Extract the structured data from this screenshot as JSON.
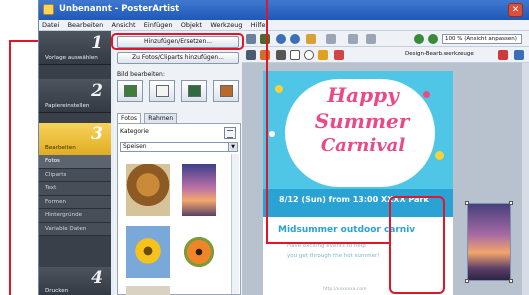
{
  "window": {
    "title": "Unbenannt - PosterArtist",
    "close_glyph": "✕"
  },
  "menubar": {
    "items": [
      "Datei",
      "Bearbeiten",
      "Ansicht",
      "Einfügen",
      "Objekt",
      "Werkzeug",
      "Hilfe"
    ]
  },
  "steps": [
    {
      "number": "1",
      "label": "Vorlage auswählen"
    },
    {
      "number": "2",
      "label": "Papiereinstellen"
    },
    {
      "number": "3",
      "label": "Bearbeiten"
    },
    {
      "number": "4",
      "label": "Drucken"
    }
  ],
  "substeps": [
    "Fotos",
    "Cliparts",
    "Text",
    "Formen",
    "Hintergründe",
    "Variable Daten"
  ],
  "panel": {
    "add_replace_button": "Hinzufügen/Ersetzen...",
    "add_to_photos_button": "Zu Fotos/Cliparts hinzufügen...",
    "image_edit_label": "Bild bearbeiten:",
    "tabs": [
      "Fotos",
      "Rahmen"
    ],
    "category_label": "Kategorie",
    "category_value": "Speisen"
  },
  "toolbar": {
    "zoom": "100 % (Ansicht anpassen)",
    "design_check_label": "Design-Bearb.werkzeuge"
  },
  "poster": {
    "line1": "Happy",
    "line2": "Summer",
    "line3": "Carnival",
    "date_line": "8/12 (Sun) from 13:00  XXXX Park",
    "mid_title": "Midsummer outdoor carniv",
    "body1": "Have exciting events to help",
    "body2": "you get through the hot summer!",
    "url": "http://xxxxxxx.com"
  },
  "colors": {
    "highlight": "#e0162b",
    "poster_sky": "#4fc6e6",
    "poster_band": "#2aa3d4",
    "poster_title": "#ea4a86",
    "active_step": "#f0c240"
  }
}
